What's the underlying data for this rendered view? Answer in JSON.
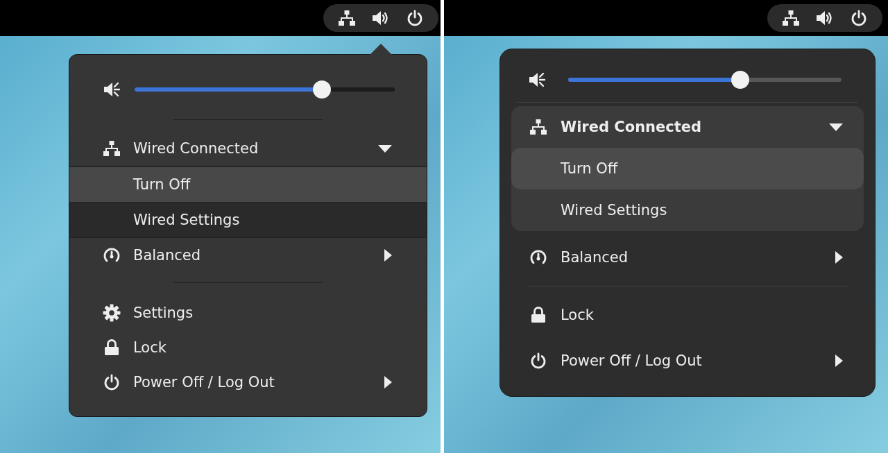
{
  "panels": [
    {
      "kind": "flat",
      "menu": {
        "items": [
          {
            "kind": "volume",
            "level": 0.72
          },
          {
            "kind": "separator"
          },
          {
            "kind": "network",
            "label": "Wired Connected",
            "expanded": true,
            "children": [
              {
                "label": "Turn Off",
                "selected": true
              },
              {
                "label": "Wired Settings",
                "selected": false
              }
            ]
          },
          {
            "kind": "power-mode",
            "label": "Balanced",
            "submenu": true
          },
          {
            "kind": "separator"
          },
          {
            "kind": "settings",
            "label": "Settings",
            "submenu": false
          },
          {
            "kind": "lock",
            "label": "Lock",
            "submenu": false
          },
          {
            "kind": "power",
            "label": "Power Off / Log Out",
            "submenu": true
          }
        ]
      }
    },
    {
      "kind": "rounded",
      "menu": {
        "items": [
          {
            "kind": "volume",
            "level": 0.63
          },
          {
            "kind": "separator"
          },
          {
            "kind": "network",
            "label": "Wired Connected",
            "expanded": true,
            "children": [
              {
                "label": "Turn Off",
                "selected": true
              },
              {
                "label": "Wired Settings",
                "selected": false
              }
            ]
          },
          {
            "kind": "power-mode",
            "label": "Balanced",
            "submenu": true
          },
          {
            "kind": "separator"
          },
          {
            "kind": "lock",
            "label": "Lock",
            "submenu": false
          },
          {
            "kind": "power",
            "label": "Power Off / Log Out",
            "submenu": true
          }
        ]
      }
    }
  ]
}
